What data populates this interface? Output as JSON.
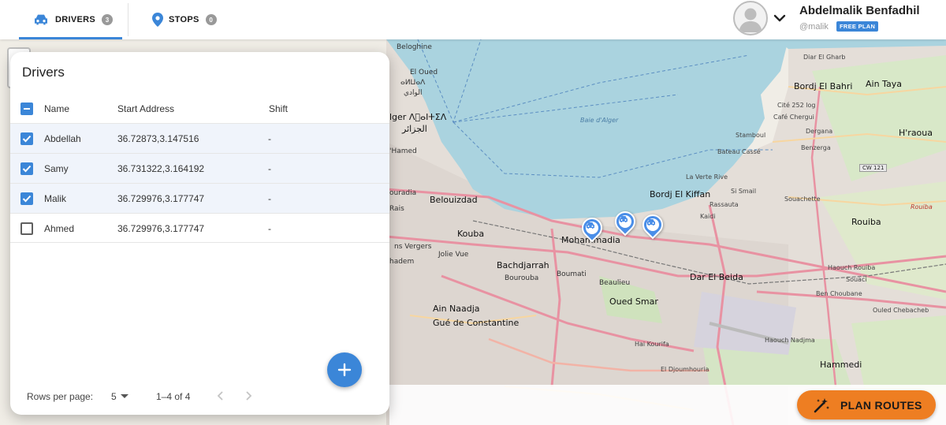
{
  "tabs": [
    {
      "label": "DRIVERS",
      "count": "3",
      "icon": "car-icon",
      "active": true
    },
    {
      "label": "STOPS",
      "count": "0",
      "icon": "location-pin-icon",
      "active": false
    }
  ],
  "user": {
    "name": "Abdelmalik Benfadhil",
    "handle": "@malik",
    "plan": "FREE PLAN"
  },
  "panel": {
    "title": "Drivers",
    "columns": {
      "name": "Name",
      "address": "Start Address",
      "shift": "Shift"
    },
    "rows": [
      {
        "name": "Abdellah",
        "address": "36.72873,3.147516",
        "shift": "-",
        "checked": true
      },
      {
        "name": "Samy",
        "address": "36.731322,3.164192",
        "shift": "-",
        "checked": true
      },
      {
        "name": "Malik",
        "address": "36.729976,3.177747",
        "shift": "-",
        "checked": true
      },
      {
        "name": "Ahmed",
        "address": "36.729976,3.177747",
        "shift": "-",
        "checked": false
      }
    ],
    "footer": {
      "rows_per_page_label": "Rows per page:",
      "rows_per_page_value": "5",
      "range": "1–4 of 4"
    }
  },
  "plan_button": {
    "label": "PLAN ROUTES",
    "icon": "magic-wand-icon"
  },
  "map": {
    "labels": {
      "beloghine": "Beloghine",
      "el_oued": "El Oued",
      "el_oued_ar": "ⴰⵍⵡⴰⴷ",
      "alger_latin": "lger ⴷ⵿ⴰⵏⵜⵉⴷ",
      "alger_ar": "الجزائر",
      "hamed": "'Hamed",
      "el_oued_ar2": "الوادي",
      "baie": "Baie d'Alger",
      "belouizdad": "Belouizdad",
      "kouba": "Kouba",
      "bachdjarrah": "Bachdjarrah",
      "bourouba": "Bourouba",
      "boumati": "Boumati",
      "beaulieu": "Beaulieu",
      "oued_smar": "Oued Smar",
      "mohammadia": "Mohammadia",
      "jolie_vue": "Jolie Vue",
      "vergers": "ns Vergers",
      "hadem": "hadem",
      "ain_naadja": "Ain Naadja",
      "gue_constantine": "Gué de Constantine",
      "hai_kourifa": "Hai Kourifa",
      "el_djoumhouria": "El Djoumhouria",
      "bordj_el_kiffan": "Bordj El Kiffan",
      "la_verte_rive": "La Verte Rive",
      "rassauta": "Rassauta",
      "si_smail": "Si Smail",
      "kaidi": "Kaidi",
      "dar_el_beida": "Dar El Beida",
      "bordj_el_bahri": "Bordj El Bahri",
      "ain_taya": "Ain Taya",
      "dirar_el_gharb": "Diar El Gharb",
      "cite_252": "Cité 252 log",
      "cafe_chergui": "Café Chergui",
      "stamboul": "Stamboul",
      "dergana": "Dergana",
      "bateau_casse": "Bateau Cassé",
      "benzerga": "Benzerga",
      "hraoua": "H'raoua",
      "souachette": "Souachette",
      "rouiba": "Rouiba",
      "rouiba_small": "Rouiba",
      "haouch_rouiba": "Haouch Rouiba",
      "souaci": "Souaci",
      "ben_choubane": "Ben Choubane",
      "ouled_chebacheb": "Ouled Chebacheb",
      "haouch_nadjma": "Haouch Nadjma",
      "hammedi": "Hammedi",
      "cw121": "CW 121",
      "ouraida": "ouradia",
      "rais": "Rais"
    }
  }
}
